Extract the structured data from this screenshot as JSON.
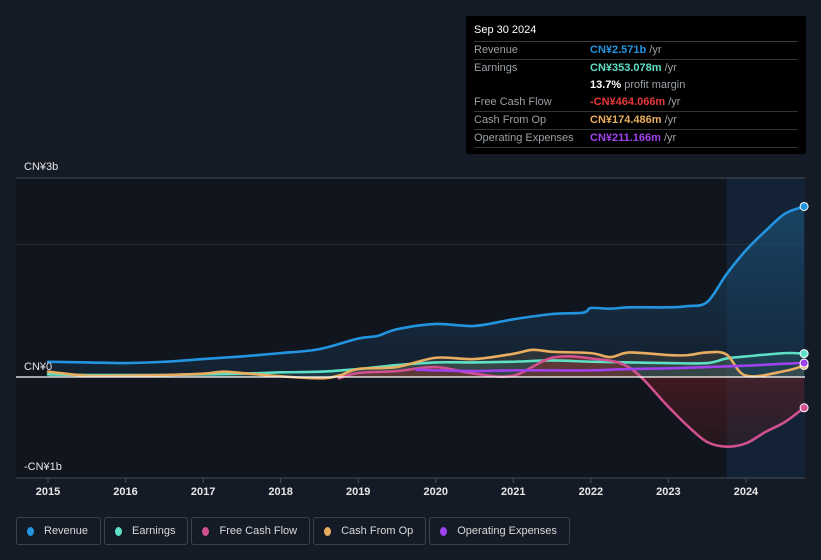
{
  "chart_data": {
    "type": "line",
    "title": "",
    "xlabel": "",
    "ylabel": "",
    "y_tick_labels": [
      "CN¥3b",
      "CN¥0",
      "-CN¥1b"
    ],
    "ylim": [
      -1.5,
      3.0
    ],
    "y_unit": "CN¥ billions",
    "x_tick_labels": [
      "2015",
      "2016",
      "2017",
      "2018",
      "2019",
      "2020",
      "2021",
      "2022",
      "2023",
      "2024"
    ],
    "xlim": [
      2014.57,
      2024.75
    ],
    "highlight_region": {
      "from": 2023.75,
      "to": 2024.75
    },
    "grid": true,
    "legend_position": "bottom-left",
    "series": [
      {
        "name": "Revenue",
        "color": "#2394df",
        "fill": true,
        "x": [
          2015.0,
          2015.5,
          2016.0,
          2016.5,
          2017.0,
          2017.5,
          2018.0,
          2018.5,
          2019.0,
          2019.25,
          2019.5,
          2020.0,
          2020.5,
          2021.0,
          2021.5,
          2021.9,
          2022.0,
          2022.25,
          2022.5,
          2023.0,
          2023.25,
          2023.5,
          2023.75,
          2024.0,
          2024.25,
          2024.5,
          2024.75
        ],
        "values": [
          0.23,
          0.22,
          0.21,
          0.23,
          0.27,
          0.31,
          0.36,
          0.42,
          0.58,
          0.62,
          0.72,
          0.8,
          0.77,
          0.87,
          0.95,
          0.97,
          1.04,
          1.03,
          1.05,
          1.05,
          1.07,
          1.13,
          1.55,
          1.91,
          2.2,
          2.46,
          2.571
        ]
      },
      {
        "name": "Earnings",
        "color": "#5ee0c7",
        "fill": true,
        "x": [
          2015.0,
          2015.5,
          2016.0,
          2016.5,
          2017.0,
          2017.5,
          2018.0,
          2018.5,
          2019.0,
          2019.5,
          2020.0,
          2020.5,
          2021.0,
          2021.5,
          2022.0,
          2022.5,
          2023.0,
          2023.5,
          2023.75,
          2024.0,
          2024.5,
          2024.75
        ],
        "values": [
          0.04,
          0.03,
          0.03,
          0.03,
          0.04,
          0.05,
          0.07,
          0.08,
          0.12,
          0.18,
          0.22,
          0.22,
          0.23,
          0.25,
          0.23,
          0.22,
          0.21,
          0.21,
          0.28,
          0.31,
          0.36,
          0.353
        ]
      },
      {
        "name": "Free Cash Flow",
        "color": "#d1508f",
        "fill": true,
        "x": [
          2018.75,
          2019.0,
          2019.5,
          2020.0,
          2020.5,
          2021.0,
          2021.5,
          2022.0,
          2022.5,
          2023.0,
          2023.25,
          2023.5,
          2023.75,
          2024.0,
          2024.25,
          2024.5,
          2024.75
        ],
        "values": [
          -0.02,
          0.06,
          0.09,
          0.15,
          0.05,
          0.02,
          0.29,
          0.28,
          0.14,
          -0.45,
          -0.74,
          -0.98,
          -1.05,
          -1.0,
          -0.83,
          -0.68,
          -0.464
        ]
      },
      {
        "name": "Cash From Op",
        "color": "#e8ad5f",
        "fill": true,
        "x": [
          2015.0,
          2015.5,
          2016.0,
          2016.5,
          2017.0,
          2017.25,
          2017.5,
          2018.0,
          2018.5,
          2018.75,
          2019.0,
          2019.5,
          2020.0,
          2020.5,
          2021.0,
          2021.25,
          2021.5,
          2022.0,
          2022.25,
          2022.5,
          2023.0,
          2023.25,
          2023.5,
          2023.75,
          2024.0,
          2024.5,
          2024.75
        ],
        "values": [
          0.08,
          0.02,
          0.02,
          0.03,
          0.05,
          0.08,
          0.06,
          0.01,
          -0.02,
          0.02,
          0.12,
          0.15,
          0.29,
          0.27,
          0.35,
          0.41,
          0.38,
          0.36,
          0.3,
          0.37,
          0.33,
          0.33,
          0.37,
          0.34,
          0.02,
          0.09,
          0.174
        ]
      },
      {
        "name": "Operating Expenses",
        "color": "#a142f0",
        "fill": false,
        "x": [
          2019.75,
          2020.0,
          2020.5,
          2021.0,
          2021.5,
          2022.0,
          2022.5,
          2023.0,
          2023.5,
          2024.0,
          2024.5,
          2024.75
        ],
        "values": [
          0.11,
          0.1,
          0.09,
          0.1,
          0.1,
          0.1,
          0.12,
          0.13,
          0.15,
          0.17,
          0.2,
          0.211
        ]
      }
    ]
  },
  "tooltip": {
    "date": "Sep 30 2024",
    "rows": [
      {
        "label": "Revenue",
        "value": "CN¥2.571b",
        "suffix": "/yr",
        "color": "#2394df"
      },
      {
        "label": "Earnings",
        "value": "CN¥353.078m",
        "suffix": "/yr",
        "color": "#5ee0c7"
      },
      {
        "label": "",
        "value": "13.7%",
        "suffix": "profit margin",
        "color": "#ffffff"
      },
      {
        "label": "Free Cash Flow",
        "value": "-CN¥464.066m",
        "suffix": "/yr",
        "color": "#e8383d"
      },
      {
        "label": "Cash From Op",
        "value": "CN¥174.486m",
        "suffix": "/yr",
        "color": "#e8ad5f"
      },
      {
        "label": "Operating Expenses",
        "value": "CN¥211.166m",
        "suffix": "/yr",
        "color": "#a142f0"
      }
    ]
  },
  "legend": [
    {
      "label": "Revenue",
      "color": "#2394df"
    },
    {
      "label": "Earnings",
      "color": "#5ee0c7"
    },
    {
      "label": "Free Cash Flow",
      "color": "#d1508f"
    },
    {
      "label": "Cash From Op",
      "color": "#e8ad5f"
    },
    {
      "label": "Operating Expenses",
      "color": "#a142f0"
    }
  ]
}
